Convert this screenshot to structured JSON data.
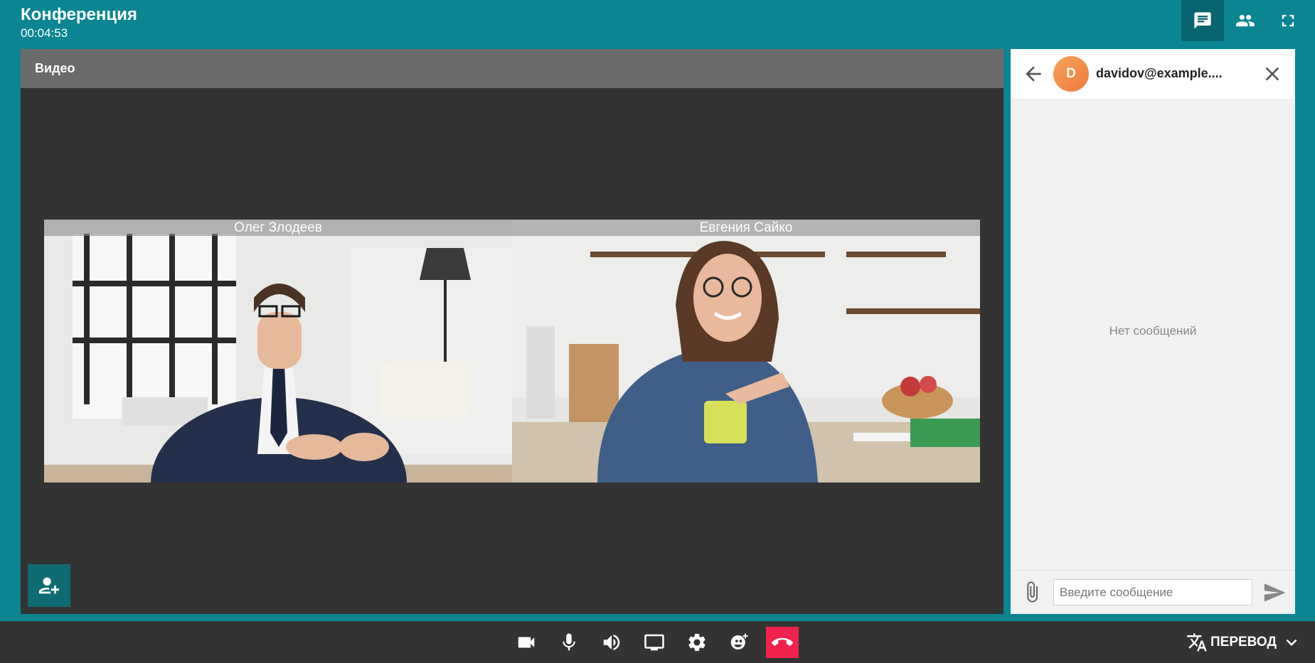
{
  "header": {
    "title": "Конференция",
    "timer": "00:04:53",
    "buttons": [
      {
        "name": "chat",
        "icon": "chat-icon",
        "active": true
      },
      {
        "name": "participants",
        "icon": "people-icon",
        "active": false
      },
      {
        "name": "fullscreen",
        "icon": "fullscreen-icon",
        "active": false
      }
    ]
  },
  "video": {
    "title": "Видео",
    "participants": [
      {
        "name": "Олег Злодеев"
      },
      {
        "name": "Евгения Сайко"
      }
    ],
    "add_participant_icon": "add-user-icon"
  },
  "chat": {
    "contact": {
      "initial": "D",
      "name": "davidov@example...."
    },
    "empty_text": "Нет сообщений",
    "input_placeholder": "Введите сообщение"
  },
  "toolbar": {
    "buttons": [
      "camera-icon",
      "microphone-icon",
      "volume-icon",
      "screen-share-icon",
      "settings-icon",
      "emoji-icon",
      "hangup-icon"
    ],
    "translate_label": "ПЕРЕВОД"
  },
  "colors": {
    "brand": "#0b8591",
    "active_button": "#086470",
    "panel_dark": "#333333",
    "hangup": "#f0234e",
    "avatar": "#f48a45"
  }
}
